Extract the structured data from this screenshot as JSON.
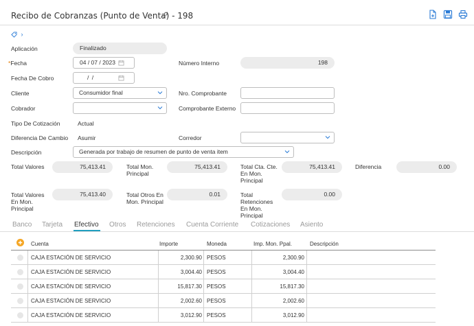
{
  "header": {
    "title": "Recibo de Cobranzas (Punto de Venta) - 198",
    "icons": [
      "link-icon",
      "new-document-icon",
      "save-icon",
      "print-icon"
    ]
  },
  "colors": {
    "accent": "#1f9ebf",
    "link": "#2a7bd6",
    "required": "#e47a00",
    "add": "#f5a623",
    "pill": "#ececec"
  },
  "form": {
    "aplicacion_label": "Aplicación",
    "aplicacion_value": "Finalizado",
    "fecha_label": "Fecha",
    "fecha_required_mark": "*",
    "fecha_value": "04 / 07 / 2023",
    "fecha_cobro_label": "Fecha De Cobro",
    "fecha_cobro_value": "/     /",
    "numero_interno_label": "Número Interno",
    "numero_interno_value": "198",
    "cliente_label": "Cliente",
    "cliente_value": "Consumidor final",
    "nro_comprobante_label": "Nro. Comprobante",
    "nro_comprobante_value": "",
    "cobrador_label": "Cobrador",
    "cobrador_value": "",
    "comprobante_externo_label": "Comprobante Externo",
    "comprobante_externo_value": "",
    "tipo_cotizacion_label": "Tipo De Cotización",
    "tipo_cotizacion_value": "Actual",
    "diferencia_cambio_label": "Diferencia De Cambio",
    "diferencia_cambio_value": "Asumir",
    "corredor_label": "Corredor",
    "corredor_value": "",
    "descripcion_label": "Descripción",
    "descripcion_value": "Generada por trabajo de resumen de punto de venta item"
  },
  "totals": {
    "total_valores_label": "Total Valores",
    "total_valores_value": "75,413.41",
    "total_mon_principal_label_1": "Total Mon.",
    "total_mon_principal_label_2": "Principal",
    "total_mon_principal_value": "75,413.41",
    "total_cta_cte_label_1": "Total Cta. Cte.",
    "total_cta_cte_label_2": "En Mon.",
    "total_cta_cte_label_3": "Principal",
    "total_cta_cte_value": "75,413.41",
    "diferencia_label": "Diferencia",
    "diferencia_value": "0.00",
    "total_valores_mon_label_1": "Total Valores",
    "total_valores_mon_label_2": "En Mon.",
    "total_valores_mon_label_3": "Principal",
    "total_valores_mon_value": "75,413.40",
    "total_otros_label_1": "Total Otros En",
    "total_otros_label_2": "Mon. Principal",
    "total_otros_value": "0.01",
    "total_retenciones_label_1": "Total",
    "total_retenciones_label_2": "Retenciones",
    "total_retenciones_label_3": "En Mon.",
    "total_retenciones_label_4": "Principal",
    "total_retenciones_value": "0.00"
  },
  "tabs": [
    "Banco",
    "Tarjeta",
    "Efectivo",
    "Otros",
    "Retenciones",
    "Cuenta Corriente",
    "Cotizaciones",
    "Asiento"
  ],
  "active_tab": "Efectivo",
  "table": {
    "headers": {
      "cuenta": "Cuenta",
      "importe": "Importe",
      "moneda": "Moneda",
      "imp_mon_ppal": "Imp. Mon. Ppal.",
      "descripcion": "Descripción"
    },
    "rows": [
      {
        "cuenta": "CAJA ESTACIÓN DE SERVICIO",
        "importe": "2,300.90",
        "moneda": "PESOS",
        "imp_mon_ppal": "2,300.90",
        "descripcion": ""
      },
      {
        "cuenta": "CAJA ESTACIÓN DE SERVICIO",
        "importe": "3,004.40",
        "moneda": "PESOS",
        "imp_mon_ppal": "3,004.40",
        "descripcion": ""
      },
      {
        "cuenta": "CAJA ESTACIÓN DE SERVICIO",
        "importe": "15,817.30",
        "moneda": "PESOS",
        "imp_mon_ppal": "15,817.30",
        "descripcion": ""
      },
      {
        "cuenta": "CAJA ESTACIÓN DE SERVICIO",
        "importe": "2,002.60",
        "moneda": "PESOS",
        "imp_mon_ppal": "2,002.60",
        "descripcion": ""
      },
      {
        "cuenta": "CAJA ESTACIÓN DE SERVICIO",
        "importe": "3,012.90",
        "moneda": "PESOS",
        "imp_mon_ppal": "3,012.90",
        "descripcion": ""
      }
    ]
  }
}
